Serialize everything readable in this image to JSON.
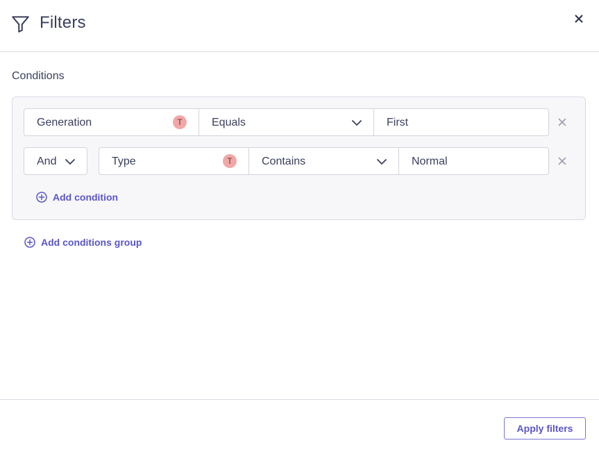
{
  "header": {
    "title": "Filters",
    "icon": "filter-icon",
    "close_icon": "close-icon"
  },
  "conditions_label": "Conditions",
  "group": {
    "rows": [
      {
        "field": "Generation",
        "field_type_badge": "T",
        "operator": "Equals",
        "value": "First"
      },
      {
        "conjunction": "And",
        "field": "Type",
        "field_type_badge": "T",
        "operator": "Contains",
        "value": "Normal"
      }
    ],
    "add_condition": "Add condition"
  },
  "add_conditions_group": "Add conditions group",
  "footer": {
    "apply_label": "Apply filters"
  },
  "colors": {
    "accent": "#5a54cc",
    "badge": "#f2a7a7",
    "border": "#d2d4dc",
    "group_bg": "#f7f7f9"
  }
}
